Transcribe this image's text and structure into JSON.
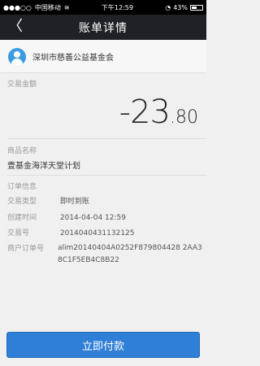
{
  "statusbar": {
    "signal": "●●●○○",
    "carrier": "中国移动",
    "time": "下午12:59",
    "battery": "43%"
  },
  "nav": {
    "back": "〈",
    "title": "账单详情"
  },
  "merchant": {
    "name": "深圳市慈善公益基金会"
  },
  "amount": {
    "label": "交易金额",
    "integer": "-23",
    "decimal": ".80"
  },
  "product": {
    "label": "商品名称",
    "value": "壹基金海洋天堂计划"
  },
  "order": {
    "header": "订单信息",
    "rows": [
      {
        "key": "交易类型",
        "value": "即时到账"
      },
      {
        "key": "创建时间",
        "value": "2014-04-04 12:59"
      },
      {
        "key": "交易号",
        "value": "2014040431132125"
      }
    ],
    "merchant_order_label": "商户订单号",
    "merchant_order_value": "alim20140404A0252F879804428 2AA38C1F5EB4C8B22"
  },
  "action": {
    "pay_label": "立即付款"
  },
  "colors": {
    "nav_bg": "#1f2124",
    "button_bg": "#2f7fd6",
    "avatar": "#3a9be0"
  }
}
